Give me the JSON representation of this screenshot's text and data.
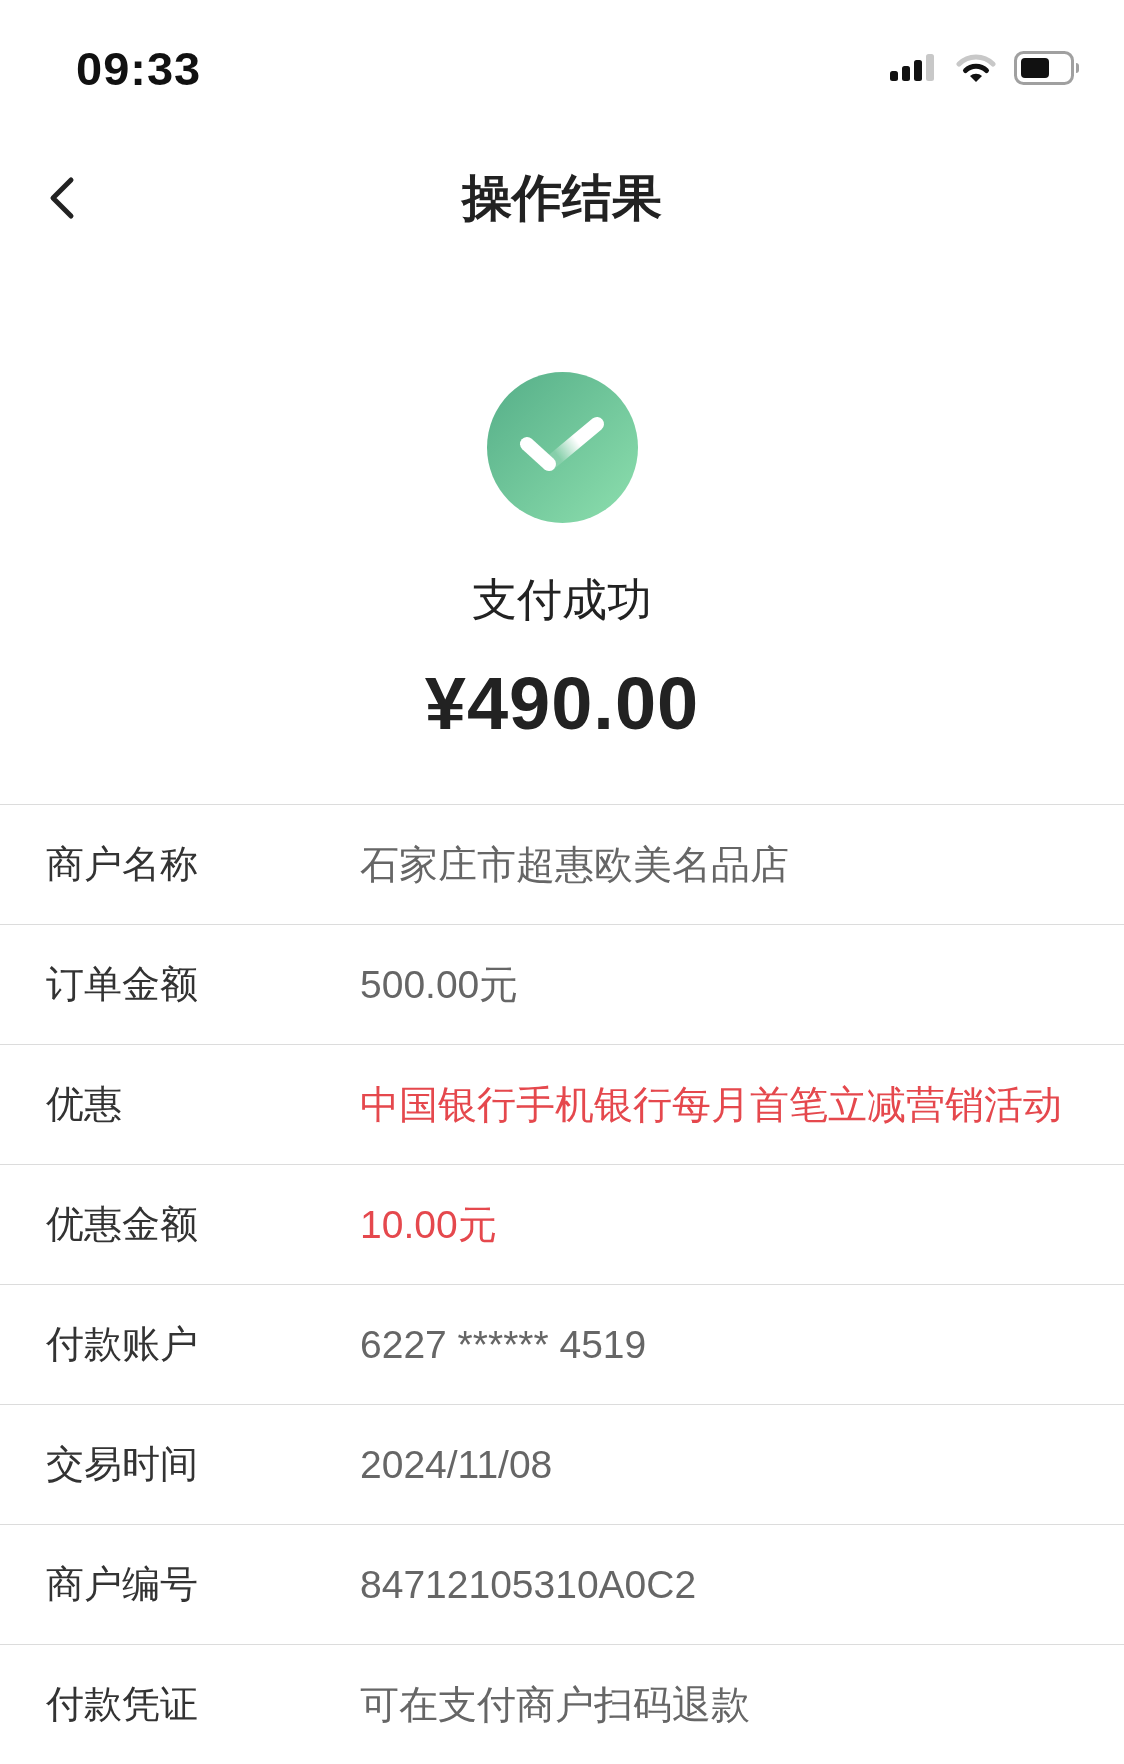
{
  "status_bar": {
    "time": "09:33"
  },
  "header": {
    "title": "操作结果"
  },
  "result": {
    "status": "支付成功",
    "amount": "¥490.00"
  },
  "details": [
    {
      "label": "商户名称",
      "value": "石家庄市超惠欧美名品店",
      "highlighted": false
    },
    {
      "label": "订单金额",
      "value": "500.00元",
      "highlighted": false
    },
    {
      "label": "优惠",
      "value": "中国银行手机银行每月首笔立减营销活动",
      "highlighted": true
    },
    {
      "label": "优惠金额",
      "value": "10.00元",
      "highlighted": true
    },
    {
      "label": "付款账户",
      "value": "6227 ****** 4519",
      "highlighted": false
    },
    {
      "label": "交易时间",
      "value": "2024/11/08",
      "highlighted": false
    },
    {
      "label": "商户编号",
      "value": "84712105310A0C2",
      "highlighted": false
    },
    {
      "label": "付款凭证",
      "value": "可在支付商户扫码退款",
      "highlighted": false
    }
  ]
}
